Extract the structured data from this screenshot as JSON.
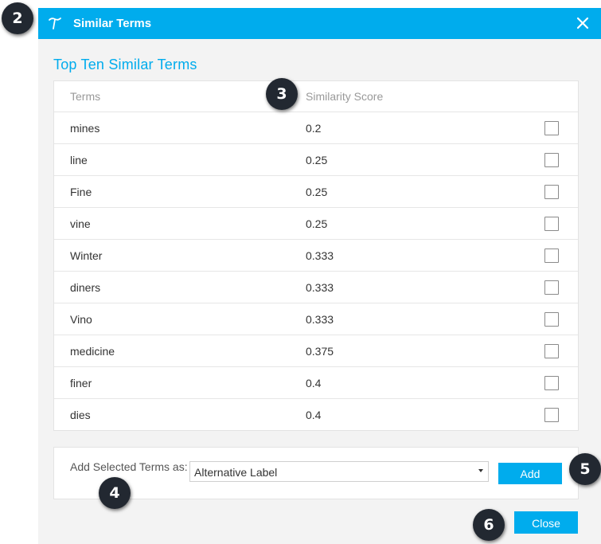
{
  "colors": {
    "accent": "#00aced",
    "badge": "#222831"
  },
  "dialog": {
    "title": "Similar Terms",
    "logo_icon": "tilde-t-icon",
    "close_icon": "close-icon"
  },
  "section_title": "Top Ten Similar Terms",
  "table": {
    "headers": {
      "term": "Terms",
      "score": "Similarity Score"
    },
    "rows": [
      {
        "term": "mines",
        "score": "0.2",
        "checked": false
      },
      {
        "term": "line",
        "score": "0.25",
        "checked": false
      },
      {
        "term": "Fine",
        "score": "0.25",
        "checked": false
      },
      {
        "term": "vine",
        "score": "0.25",
        "checked": false
      },
      {
        "term": "Winter",
        "score": "0.333",
        "checked": false
      },
      {
        "term": "diners",
        "score": "0.333",
        "checked": false
      },
      {
        "term": "Vino",
        "score": "0.333",
        "checked": false
      },
      {
        "term": "medicine",
        "score": "0.375",
        "checked": false
      },
      {
        "term": "finer",
        "score": "0.4",
        "checked": false
      },
      {
        "term": "dies",
        "score": "0.4",
        "checked": false
      }
    ]
  },
  "add_panel": {
    "label": "Add Selected Terms as:",
    "select_value": "Alternative Label",
    "add_button": "Add"
  },
  "close_button": "Close",
  "badges": [
    "2",
    "3",
    "4",
    "5",
    "6"
  ]
}
